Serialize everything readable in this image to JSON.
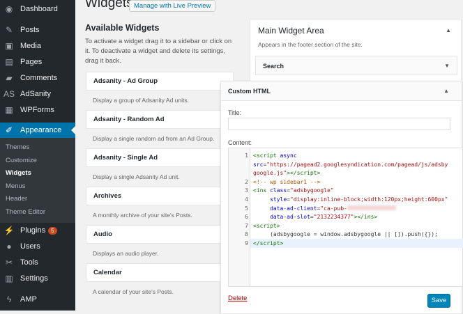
{
  "sidebar": {
    "items": [
      {
        "label": "Dashboard",
        "icon": "dashboard-icon",
        "glyph": "◉"
      },
      {
        "label": "Posts",
        "icon": "pin-icon",
        "glyph": "✎"
      },
      {
        "label": "Media",
        "icon": "media-icon",
        "glyph": "▣"
      },
      {
        "label": "Pages",
        "icon": "pages-icon",
        "glyph": "▤"
      },
      {
        "label": "Comments",
        "icon": "comment-icon",
        "glyph": "▰"
      },
      {
        "label": "AdSanity",
        "icon": "adsanity-icon",
        "glyph": "AS"
      },
      {
        "label": "WPForms",
        "icon": "wpforms-icon",
        "glyph": "▦"
      },
      {
        "label": "Appearance",
        "icon": "brush-icon",
        "glyph": "✐"
      },
      {
        "label": "Plugins",
        "icon": "plugin-icon",
        "glyph": "⚡",
        "badge": "5"
      },
      {
        "label": "Users",
        "icon": "user-icon",
        "glyph": "●"
      },
      {
        "label": "Tools",
        "icon": "wrench-icon",
        "glyph": "✂"
      },
      {
        "label": "Settings",
        "icon": "settings-icon",
        "glyph": "▥"
      },
      {
        "label": "AMP",
        "icon": "amp-icon",
        "glyph": "ϟ"
      }
    ],
    "submenu": [
      "Themes",
      "Customize",
      "Widgets",
      "Menus",
      "Header",
      "Theme Editor"
    ]
  },
  "page": {
    "title": "Widgets",
    "live_preview": "Manage with Live Preview"
  },
  "available": {
    "heading": "Available Widgets",
    "description": "To activate a widget drag it to a sidebar or click on it. To deactivate a widget and delete its settings, drag it back.",
    "widgets": [
      {
        "title": "Adsanity - Ad Group",
        "desc": "Display a group of Adsanity Ad units."
      },
      {
        "title": "Adsanity - Random Ad",
        "desc": "Display a single random ad from an Ad Group."
      },
      {
        "title": "Adsanity - Single Ad",
        "desc": "Display a single Adsanity Ad unit."
      },
      {
        "title": "Archives",
        "desc": "A monthly archive of your site's Posts."
      },
      {
        "title": "Audio",
        "desc": "Displays an audio player."
      },
      {
        "title": "Calendar",
        "desc": "A calendar of your site's Posts."
      }
    ]
  },
  "area": {
    "title": "Main Widget Area",
    "description": "Appears in the footer section of the site.",
    "search": "Search"
  },
  "custom_html": {
    "title": "Custom HTML",
    "title_label": "Title:",
    "title_value": "",
    "content_label": "Content:",
    "delete": "Delete",
    "save": "Save",
    "lines": [
      {
        "n": "1",
        "html": "<span class='tag'>&lt;script</span> <span class='att'>async</span>"
      },
      {
        "n": "",
        "html": "<span class='att'>src</span>=<span class='str'>\"https://pagead2.googlesyndication.com/pagead/js/adsby</span>"
      },
      {
        "n": "",
        "html": "<span class='str'>google.js\"</span><span class='tag'>&gt;&lt;/script&gt;</span>"
      },
      {
        "n": "2",
        "html": "<span class='cm'>&lt;!-- wp sidebar1 --&gt;</span>"
      },
      {
        "n": "3",
        "html": "<span class='tag'>&lt;ins</span> <span class='att'>class</span>=<span class='str'>\"adsbygoogle\"</span>"
      },
      {
        "n": "4",
        "html": "     <span class='att'>style</span>=<span class='str'>\"display:inline-block;width:120px;height:600px\"</span>"
      },
      {
        "n": "5",
        "html": "     <span class='att'>data-ad-client</span>=<span class='str'>\"ca-pub-</span><span class='blur'></span>"
      },
      {
        "n": "6",
        "html": "     <span class='att'>data-ad-slot</span>=<span class='str'>\"2132234377\"</span><span class='tag'>&gt;&lt;/ins&gt;</span>"
      },
      {
        "n": "7",
        "html": "<span class='tag'>&lt;script&gt;</span>"
      },
      {
        "n": "8",
        "html": "     (adsbygoogle = window.adsbygoogle || []).push({});"
      },
      {
        "n": "9",
        "html": "<span class='tag'>&lt;/script&gt;</span>"
      }
    ]
  }
}
